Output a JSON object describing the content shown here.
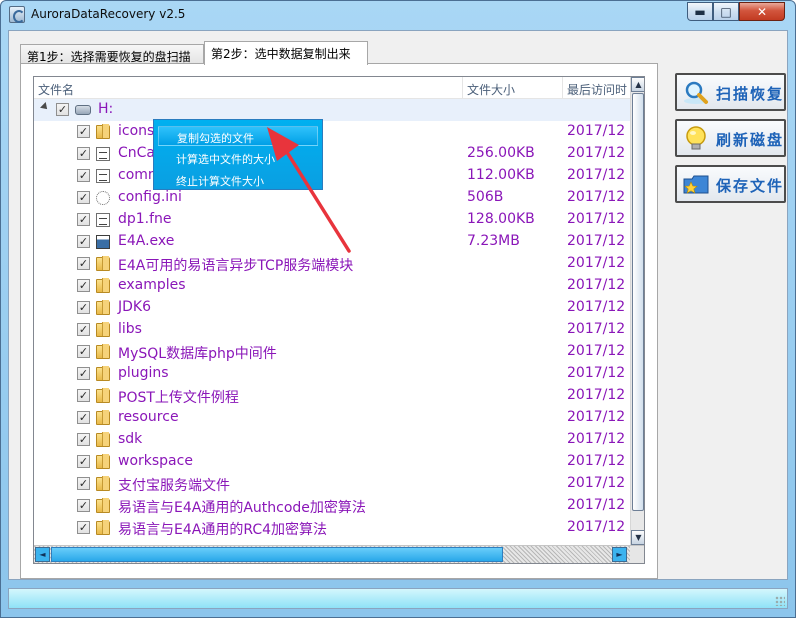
{
  "window": {
    "title": "AuroraDataRecovery v2.5",
    "controls": {
      "minimize": "▬",
      "maximize": "□",
      "close": "✕"
    }
  },
  "tabs": [
    {
      "label": "第1步：选择需要恢复的盘扫描",
      "active": false
    },
    {
      "label": "第2步：选中数据复制出来",
      "active": true
    }
  ],
  "list": {
    "columns": {
      "name": "文件名",
      "size": "文件大小",
      "date": "最后访问时"
    },
    "root": {
      "name": "H:",
      "checked": true,
      "icon": "drive-icon"
    },
    "rows": [
      {
        "name": "icons",
        "size": "",
        "date": "2017/12",
        "icon": "folder-icon",
        "checked": true
      },
      {
        "name": "CnCa",
        "size": "256.00KB",
        "date": "2017/12",
        "icon": "file-icon",
        "checked": true
      },
      {
        "name": "comm",
        "size": "112.00KB",
        "date": "2017/12",
        "icon": "file-icon",
        "checked": true
      },
      {
        "name": "config.ini",
        "size": "506B",
        "date": "2017/12",
        "icon": "gear-icon",
        "checked": true
      },
      {
        "name": "dp1.fne",
        "size": "128.00KB",
        "date": "2017/12",
        "icon": "file-icon",
        "checked": true
      },
      {
        "name": "E4A.exe",
        "size": "7.23MB",
        "date": "2017/12",
        "icon": "exe-icon",
        "checked": true
      },
      {
        "name": "E4A可用的易语言异步TCP服务端模块",
        "size": "",
        "date": "2017/12",
        "icon": "folder-icon",
        "checked": true
      },
      {
        "name": "examples",
        "size": "",
        "date": "2017/12",
        "icon": "folder-icon",
        "checked": true
      },
      {
        "name": "JDK6",
        "size": "",
        "date": "2017/12",
        "icon": "folder-icon",
        "checked": true
      },
      {
        "name": "libs",
        "size": "",
        "date": "2017/12",
        "icon": "folder-icon",
        "checked": true
      },
      {
        "name": "MySQL数据库php中间件",
        "size": "",
        "date": "2017/12",
        "icon": "folder-icon",
        "checked": true
      },
      {
        "name": "plugins",
        "size": "",
        "date": "2017/12",
        "icon": "folder-icon",
        "checked": true
      },
      {
        "name": "POST上传文件例程",
        "size": "",
        "date": "2017/12",
        "icon": "folder-icon",
        "checked": true
      },
      {
        "name": "resource",
        "size": "",
        "date": "2017/12",
        "icon": "folder-icon",
        "checked": true
      },
      {
        "name": "sdk",
        "size": "",
        "date": "2017/12",
        "icon": "folder-icon",
        "checked": true
      },
      {
        "name": "workspace",
        "size": "",
        "date": "2017/12",
        "icon": "folder-icon",
        "checked": true
      },
      {
        "name": "支付宝服务端文件",
        "size": "",
        "date": "2017/12",
        "icon": "folder-icon",
        "checked": true
      },
      {
        "name": "易语言与E4A通用的Authcode加密算法",
        "size": "",
        "date": "2017/12",
        "icon": "folder-icon",
        "checked": true
      },
      {
        "name": "易语言与E4A通用的RC4加密算法",
        "size": "",
        "date": "2017/12",
        "icon": "folder-icon",
        "checked": true
      }
    ]
  },
  "context_menu": {
    "items": [
      {
        "label": "复制勾选的文件",
        "highlighted": true
      },
      {
        "label": "计算选中文件的大小",
        "highlighted": false
      },
      {
        "label": "终止计算文件大小",
        "highlighted": false
      }
    ]
  },
  "side_buttons": {
    "scan": {
      "label": "扫描恢复",
      "icon": "magnifier-icon"
    },
    "refresh": {
      "label": "刷新磁盘",
      "icon": "lightbulb-icon"
    },
    "save": {
      "label": "保存文件",
      "icon": "folder-star-icon"
    }
  },
  "scrollbars": {
    "up": "▲",
    "down": "▼",
    "left": "◄",
    "right": "►"
  },
  "colors": {
    "item_text": "#8a16b8",
    "menu_bg": "#00b0f0",
    "button_text": "#1e63b8",
    "annotation_arrow": "#e8343c"
  }
}
